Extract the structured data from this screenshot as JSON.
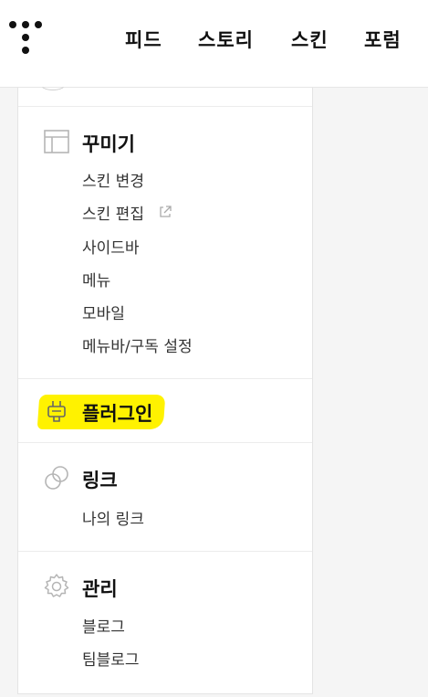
{
  "header": {
    "nav": [
      "피드",
      "스토리",
      "스킨",
      "포럼"
    ]
  },
  "sections": {
    "decorate": {
      "title": "꾸미기",
      "icon": "layout-icon",
      "items": [
        "스킨 변경",
        "스킨 편집",
        "사이드바",
        "메뉴",
        "모바일",
        "메뉴바/구독 설정"
      ]
    },
    "plugin": {
      "title": "플러그인",
      "icon": "plug-icon",
      "highlight_color": "#fff200"
    },
    "link": {
      "title": "링크",
      "icon": "link-icon",
      "items": [
        "나의 링크"
      ]
    },
    "manage": {
      "title": "관리",
      "icon": "gear-icon",
      "items": [
        "블로그",
        "팀블로그"
      ]
    }
  }
}
